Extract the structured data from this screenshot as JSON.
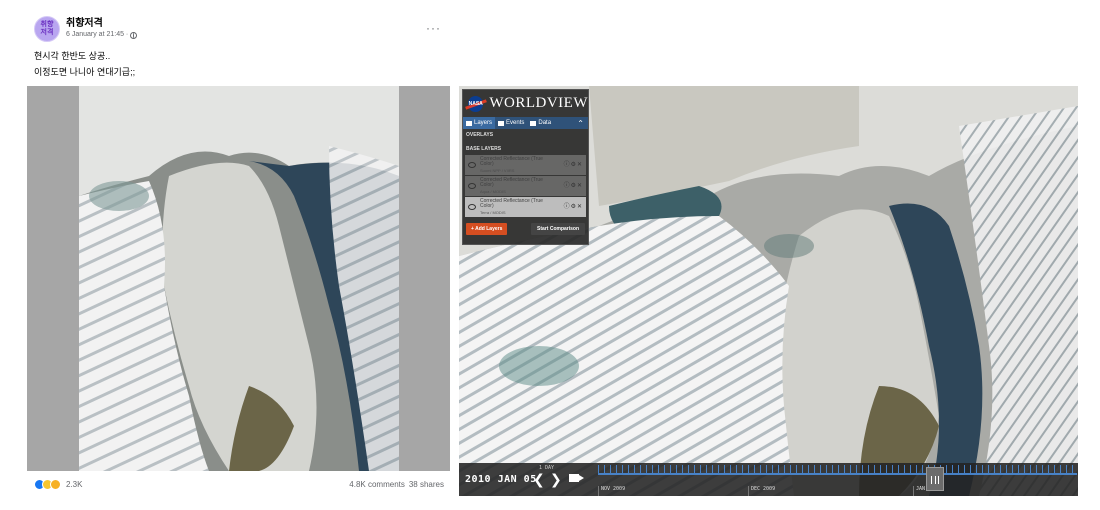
{
  "post": {
    "avatar_text": "취향\n저격",
    "author": "취향저격",
    "timestamp": "6 January at 21:45 ·",
    "more_label": "···",
    "text_line1": "현시각 한반도 상공..",
    "text_line2": "이정도면 나니아 연대기급;;",
    "reaction_count": "2.3K",
    "comments": "4.8K comments",
    "shares": "38 shares"
  },
  "worldview": {
    "brand": "WORLDVIEW",
    "nasa_label": "NASA",
    "tabs": [
      "Layers",
      "Events",
      "Data"
    ],
    "overlays_header": "OVERLAYS",
    "base_layers_header": "BASE LAYERS",
    "layers": [
      {
        "name": "Corrected Reflectance (True Color)",
        "source": "Suomi NPP / VIIRS"
      },
      {
        "name": "Corrected Reflectance (True Color)",
        "source": "Aqua / MODIS"
      },
      {
        "name": "Corrected Reflectance (True Color)",
        "source": "Terra / MODIS"
      }
    ],
    "add_layers_label": "+ Add Layers",
    "compare_label": "Start Comparison"
  },
  "timeline": {
    "date": "2010 JAN 05",
    "step": "1 DAY",
    "labels": [
      "NOV 2009",
      "DEC 2009",
      "JAN 2010"
    ]
  },
  "colors": {
    "reaction_like": "#1877f2",
    "add_layers": "#d54e21",
    "timeline_accent": "#4a8ad6",
    "ocean": "#2e4659"
  }
}
